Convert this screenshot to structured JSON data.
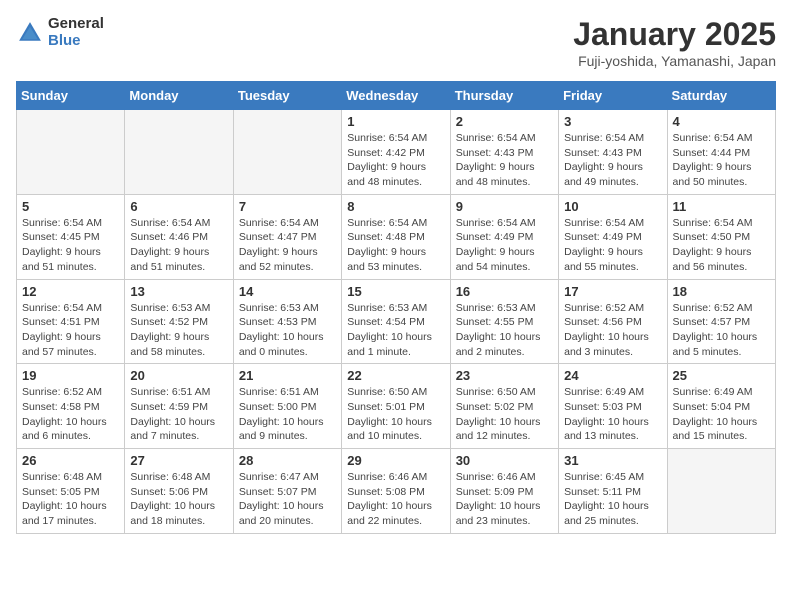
{
  "header": {
    "logo_general": "General",
    "logo_blue": "Blue",
    "title": "January 2025",
    "subtitle": "Fuji-yoshida, Yamanashi, Japan"
  },
  "weekdays": [
    "Sunday",
    "Monday",
    "Tuesday",
    "Wednesday",
    "Thursday",
    "Friday",
    "Saturday"
  ],
  "weeks": [
    [
      {
        "day": "",
        "info": ""
      },
      {
        "day": "",
        "info": ""
      },
      {
        "day": "",
        "info": ""
      },
      {
        "day": "1",
        "info": "Sunrise: 6:54 AM\nSunset: 4:42 PM\nDaylight: 9 hours\nand 48 minutes."
      },
      {
        "day": "2",
        "info": "Sunrise: 6:54 AM\nSunset: 4:43 PM\nDaylight: 9 hours\nand 48 minutes."
      },
      {
        "day": "3",
        "info": "Sunrise: 6:54 AM\nSunset: 4:43 PM\nDaylight: 9 hours\nand 49 minutes."
      },
      {
        "day": "4",
        "info": "Sunrise: 6:54 AM\nSunset: 4:44 PM\nDaylight: 9 hours\nand 50 minutes."
      }
    ],
    [
      {
        "day": "5",
        "info": "Sunrise: 6:54 AM\nSunset: 4:45 PM\nDaylight: 9 hours\nand 51 minutes."
      },
      {
        "day": "6",
        "info": "Sunrise: 6:54 AM\nSunset: 4:46 PM\nDaylight: 9 hours\nand 51 minutes."
      },
      {
        "day": "7",
        "info": "Sunrise: 6:54 AM\nSunset: 4:47 PM\nDaylight: 9 hours\nand 52 minutes."
      },
      {
        "day": "8",
        "info": "Sunrise: 6:54 AM\nSunset: 4:48 PM\nDaylight: 9 hours\nand 53 minutes."
      },
      {
        "day": "9",
        "info": "Sunrise: 6:54 AM\nSunset: 4:49 PM\nDaylight: 9 hours\nand 54 minutes."
      },
      {
        "day": "10",
        "info": "Sunrise: 6:54 AM\nSunset: 4:49 PM\nDaylight: 9 hours\nand 55 minutes."
      },
      {
        "day": "11",
        "info": "Sunrise: 6:54 AM\nSunset: 4:50 PM\nDaylight: 9 hours\nand 56 minutes."
      }
    ],
    [
      {
        "day": "12",
        "info": "Sunrise: 6:54 AM\nSunset: 4:51 PM\nDaylight: 9 hours\nand 57 minutes."
      },
      {
        "day": "13",
        "info": "Sunrise: 6:53 AM\nSunset: 4:52 PM\nDaylight: 9 hours\nand 58 minutes."
      },
      {
        "day": "14",
        "info": "Sunrise: 6:53 AM\nSunset: 4:53 PM\nDaylight: 10 hours\nand 0 minutes."
      },
      {
        "day": "15",
        "info": "Sunrise: 6:53 AM\nSunset: 4:54 PM\nDaylight: 10 hours\nand 1 minute."
      },
      {
        "day": "16",
        "info": "Sunrise: 6:53 AM\nSunset: 4:55 PM\nDaylight: 10 hours\nand 2 minutes."
      },
      {
        "day": "17",
        "info": "Sunrise: 6:52 AM\nSunset: 4:56 PM\nDaylight: 10 hours\nand 3 minutes."
      },
      {
        "day": "18",
        "info": "Sunrise: 6:52 AM\nSunset: 4:57 PM\nDaylight: 10 hours\nand 5 minutes."
      }
    ],
    [
      {
        "day": "19",
        "info": "Sunrise: 6:52 AM\nSunset: 4:58 PM\nDaylight: 10 hours\nand 6 minutes."
      },
      {
        "day": "20",
        "info": "Sunrise: 6:51 AM\nSunset: 4:59 PM\nDaylight: 10 hours\nand 7 minutes."
      },
      {
        "day": "21",
        "info": "Sunrise: 6:51 AM\nSunset: 5:00 PM\nDaylight: 10 hours\nand 9 minutes."
      },
      {
        "day": "22",
        "info": "Sunrise: 6:50 AM\nSunset: 5:01 PM\nDaylight: 10 hours\nand 10 minutes."
      },
      {
        "day": "23",
        "info": "Sunrise: 6:50 AM\nSunset: 5:02 PM\nDaylight: 10 hours\nand 12 minutes."
      },
      {
        "day": "24",
        "info": "Sunrise: 6:49 AM\nSunset: 5:03 PM\nDaylight: 10 hours\nand 13 minutes."
      },
      {
        "day": "25",
        "info": "Sunrise: 6:49 AM\nSunset: 5:04 PM\nDaylight: 10 hours\nand 15 minutes."
      }
    ],
    [
      {
        "day": "26",
        "info": "Sunrise: 6:48 AM\nSunset: 5:05 PM\nDaylight: 10 hours\nand 17 minutes."
      },
      {
        "day": "27",
        "info": "Sunrise: 6:48 AM\nSunset: 5:06 PM\nDaylight: 10 hours\nand 18 minutes."
      },
      {
        "day": "28",
        "info": "Sunrise: 6:47 AM\nSunset: 5:07 PM\nDaylight: 10 hours\nand 20 minutes."
      },
      {
        "day": "29",
        "info": "Sunrise: 6:46 AM\nSunset: 5:08 PM\nDaylight: 10 hours\nand 22 minutes."
      },
      {
        "day": "30",
        "info": "Sunrise: 6:46 AM\nSunset: 5:09 PM\nDaylight: 10 hours\nand 23 minutes."
      },
      {
        "day": "31",
        "info": "Sunrise: 6:45 AM\nSunset: 5:11 PM\nDaylight: 10 hours\nand 25 minutes."
      },
      {
        "day": "",
        "info": ""
      }
    ]
  ]
}
